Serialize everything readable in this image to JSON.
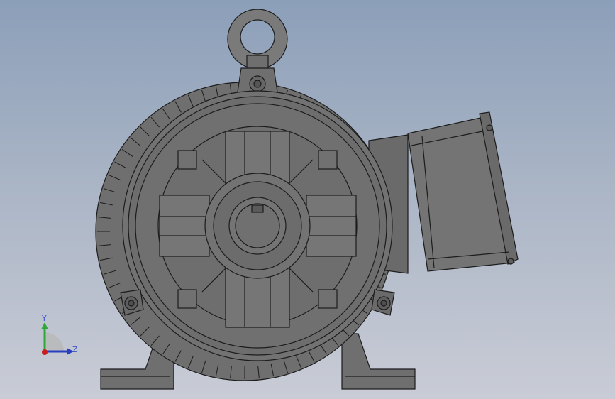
{
  "viewport": {
    "background_top": "#8c9fb9",
    "background_bottom": "#c9ccd6"
  },
  "model": {
    "object": "electric-motor",
    "view": "front",
    "body_color": "#6f6f6f",
    "edge_color": "#1c1c1c",
    "highlight_color": "#8a8a8a"
  },
  "triad": {
    "y_label": "Y",
    "z_label": "Z",
    "y_color": "#2fa83a",
    "z_color": "#2a3fc0",
    "x_color": "#c81e1e"
  }
}
